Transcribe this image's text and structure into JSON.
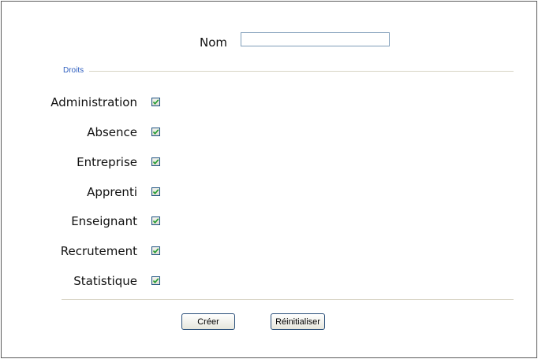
{
  "form": {
    "name_label": "Nom",
    "name_value": "",
    "rights_legend": "Droits",
    "permissions": [
      {
        "label": "Administration",
        "checked": true
      },
      {
        "label": "Absence",
        "checked": true
      },
      {
        "label": "Entreprise",
        "checked": true
      },
      {
        "label": "Apprenti",
        "checked": true
      },
      {
        "label": "Enseignant",
        "checked": true
      },
      {
        "label": "Recrutement",
        "checked": true
      },
      {
        "label": "Statistique",
        "checked": true
      }
    ],
    "create_label": "Créer",
    "reset_label": "Réinitialiser"
  },
  "colors": {
    "legend": "#2f5fbf",
    "checkmark": "#1f9b2f",
    "border": "#5a5a5a"
  }
}
